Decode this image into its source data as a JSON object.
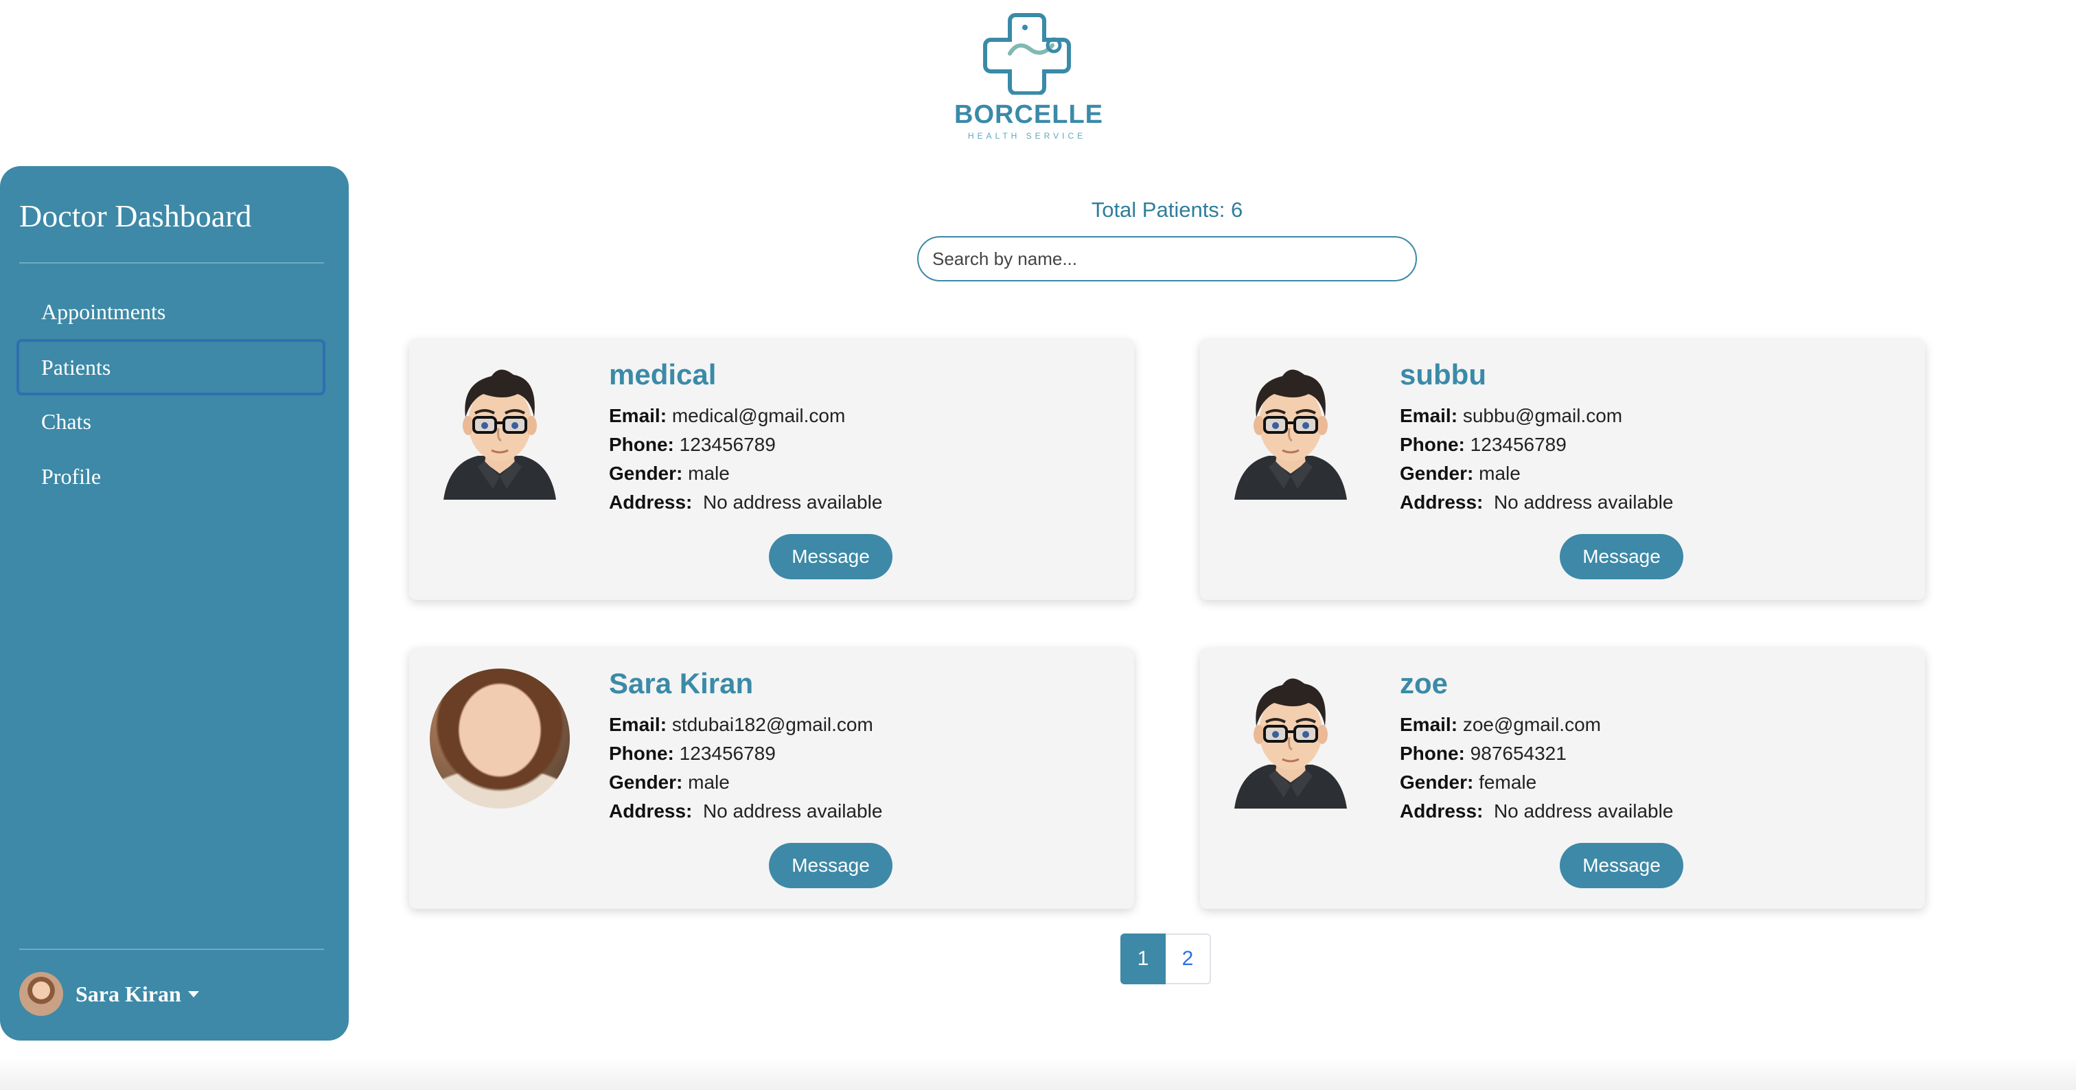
{
  "brand": {
    "name": "BORCELLE",
    "tagline": "HEALTH SERVICE"
  },
  "sidebar": {
    "title": "Doctor Dashboard",
    "items": [
      {
        "label": "Appointments",
        "active": false
      },
      {
        "label": "Patients",
        "active": true
      },
      {
        "label": "Chats",
        "active": false
      },
      {
        "label": "Profile",
        "active": false
      }
    ],
    "user": {
      "name": "Sara Kiran"
    }
  },
  "main": {
    "total_label": "Total Patients: 6",
    "search": {
      "placeholder": "Search by name...",
      "value": ""
    }
  },
  "labels": {
    "email": "Email:",
    "phone": "Phone:",
    "gender": "Gender:",
    "address": "Address:"
  },
  "patients": [
    {
      "name": "medical",
      "email": "medical@gmail.com",
      "phone": "123456789",
      "gender": "male",
      "address": "No address available",
      "avatar": "cartoon-avatar-icon",
      "button": "Message"
    },
    {
      "name": "subbu",
      "email": "subbu@gmail.com",
      "phone": "123456789",
      "gender": "male",
      "address": "No address available",
      "avatar": "cartoon-avatar-icon",
      "button": "Message"
    },
    {
      "name": "Sara Kiran",
      "email": "stdubai182@gmail.com",
      "phone": "123456789",
      "gender": "male",
      "address": "No address available",
      "avatar": "photo-avatar",
      "button": "Message"
    },
    {
      "name": "zoe",
      "email": "zoe@gmail.com",
      "phone": "987654321",
      "gender": "female",
      "address": "No address available",
      "avatar": "cartoon-avatar-icon",
      "button": "Message"
    }
  ],
  "pagination": {
    "pages": [
      "1",
      "2"
    ],
    "current": "1"
  },
  "colors": {
    "accent": "#3d89a7",
    "accent_text": "#2f7e9c",
    "card_bg": "#f4f4f4",
    "active_border": "#2f6fb0"
  }
}
